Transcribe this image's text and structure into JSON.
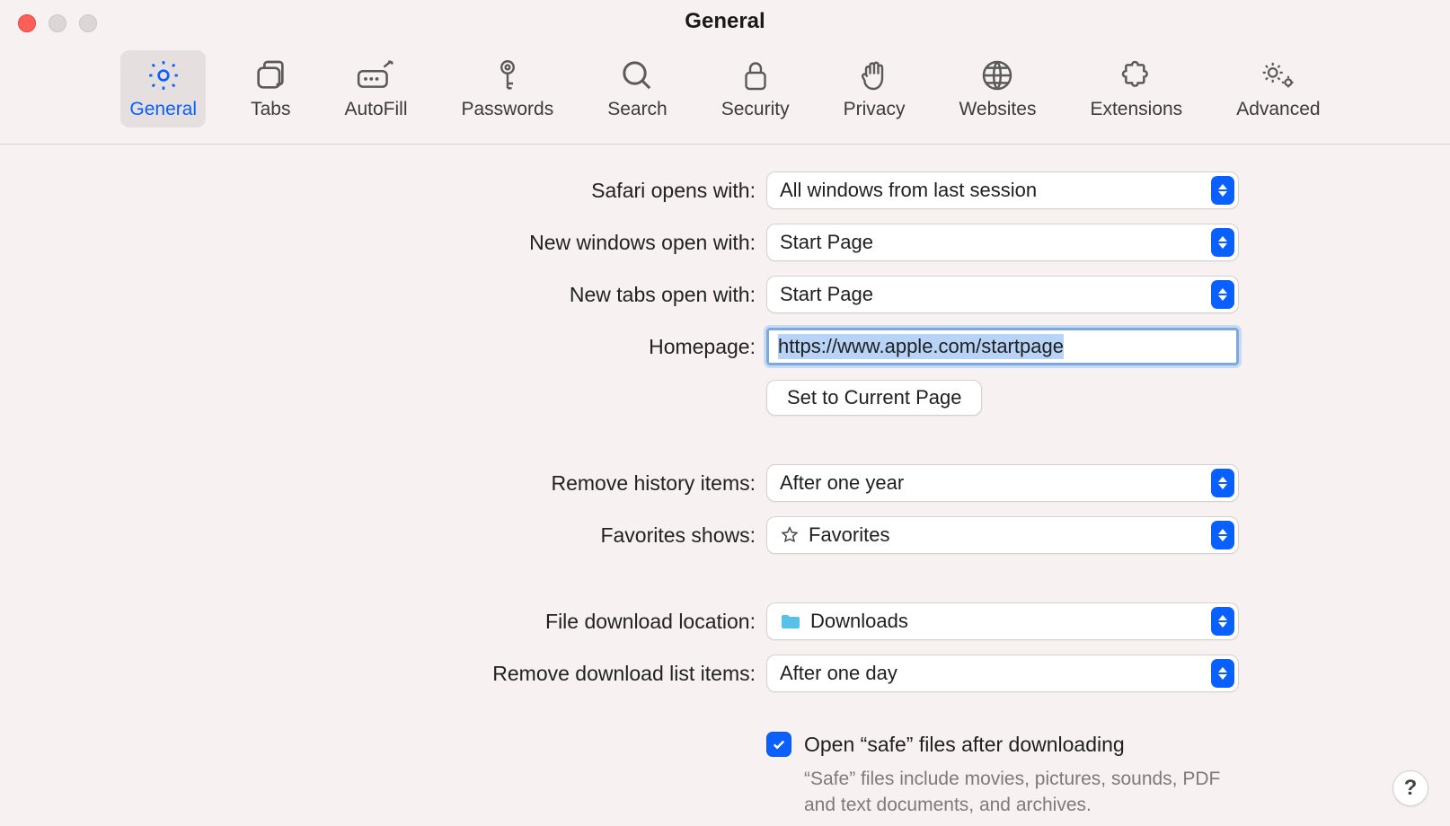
{
  "window": {
    "title": "General"
  },
  "toolbar": {
    "items": [
      {
        "id": "general",
        "label": "General"
      },
      {
        "id": "tabs",
        "label": "Tabs"
      },
      {
        "id": "autofill",
        "label": "AutoFill"
      },
      {
        "id": "passwords",
        "label": "Passwords"
      },
      {
        "id": "search",
        "label": "Search"
      },
      {
        "id": "security",
        "label": "Security"
      },
      {
        "id": "privacy",
        "label": "Privacy"
      },
      {
        "id": "websites",
        "label": "Websites"
      },
      {
        "id": "extensions",
        "label": "Extensions"
      },
      {
        "id": "advanced",
        "label": "Advanced"
      }
    ]
  },
  "form": {
    "safari_opens_with": {
      "label": "Safari opens with:",
      "value": "All windows from last session"
    },
    "new_windows": {
      "label": "New windows open with:",
      "value": "Start Page"
    },
    "new_tabs": {
      "label": "New tabs open with:",
      "value": "Start Page"
    },
    "homepage": {
      "label": "Homepage:",
      "value": "https://www.apple.com/startpage"
    },
    "set_current": {
      "label": "Set to Current Page"
    },
    "remove_history": {
      "label": "Remove history items:",
      "value": "After one year"
    },
    "favorites_shows": {
      "label": "Favorites shows:",
      "value": "Favorites"
    },
    "download_location": {
      "label": "File download location:",
      "value": "Downloads"
    },
    "remove_downloads": {
      "label": "Remove download list items:",
      "value": "After one day"
    },
    "open_safe": {
      "label": "Open “safe” files after downloading",
      "checked": true,
      "hint": "“Safe” files include movies, pictures, sounds, PDF and text documents, and archives."
    }
  },
  "help": {
    "label": "?"
  }
}
